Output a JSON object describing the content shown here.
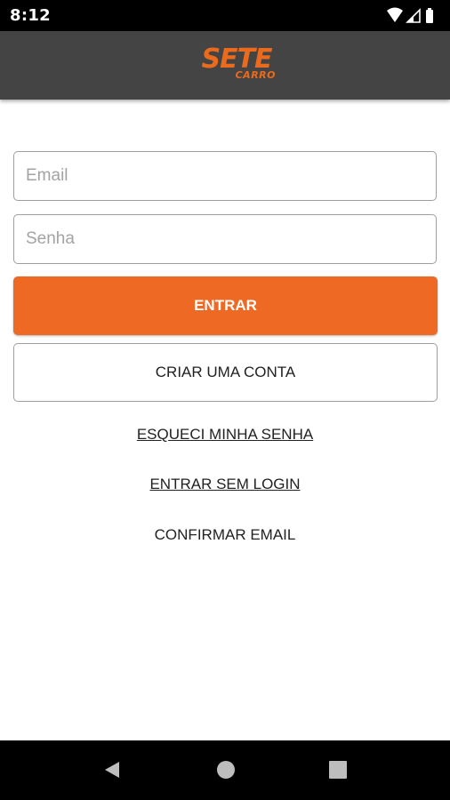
{
  "status_bar": {
    "time": "8:12",
    "icons": [
      "wifi-icon",
      "signal-icon",
      "battery-icon"
    ]
  },
  "header": {
    "logo_main": "SETE",
    "logo_sub": "CARRO",
    "brand_color": "#ea6b1d"
  },
  "form": {
    "email_placeholder": "Email",
    "email_value": "",
    "password_placeholder": "Senha",
    "password_value": ""
  },
  "buttons": {
    "login_label": "ENTRAR",
    "create_account_label": "CRIAR UMA CONTA"
  },
  "links": {
    "forgot_password": "ESQUECI MINHA SENHA",
    "enter_without_login": "ENTRAR SEM LOGIN",
    "confirm_email": "CONFIRMAR EMAIL"
  },
  "nav_bar": {
    "icons": [
      "back-icon",
      "home-icon",
      "recents-icon"
    ]
  },
  "colors": {
    "accent": "#ee6a24",
    "app_bar": "#444444"
  }
}
